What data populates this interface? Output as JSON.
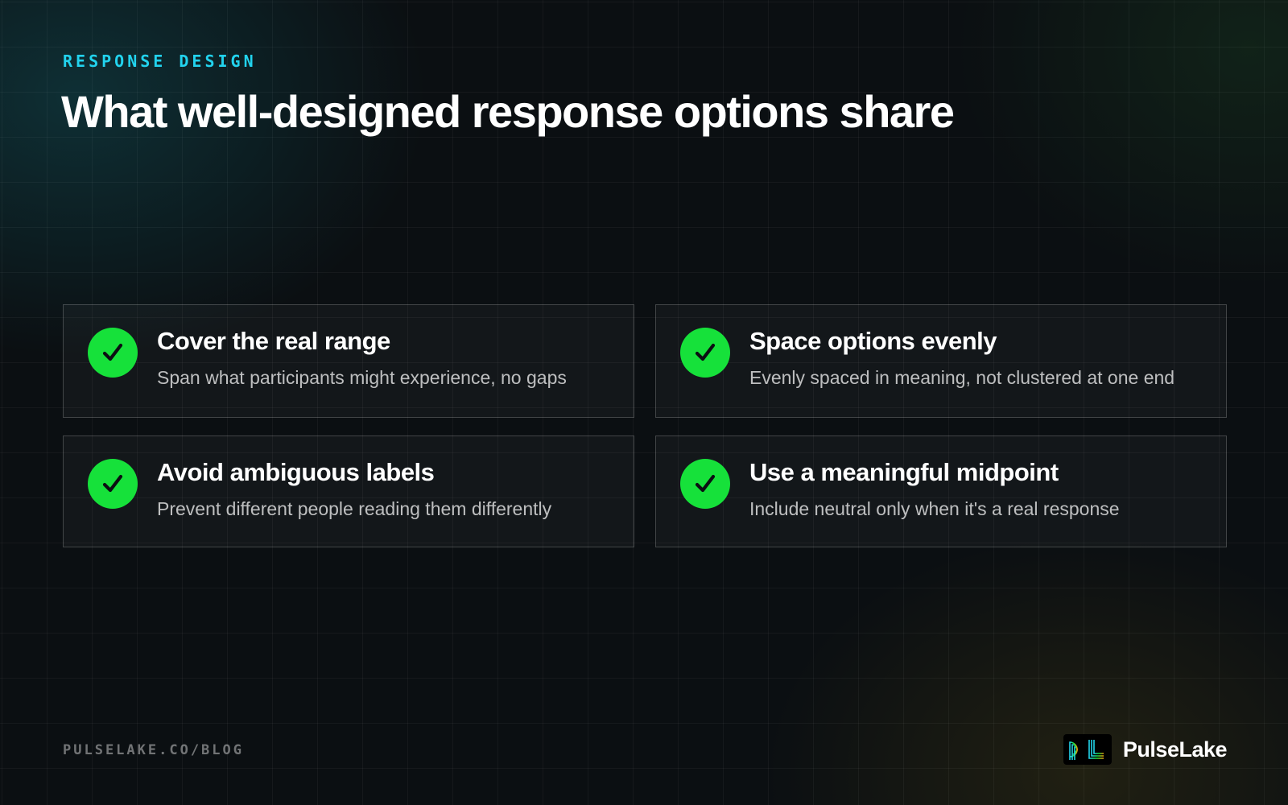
{
  "header": {
    "eyebrow": "RESPONSE DESIGN",
    "title": "What well-designed response options share"
  },
  "cards": [
    {
      "icon": "check-icon",
      "title": "Cover the real range",
      "description": "Span what participants might experience, no gaps"
    },
    {
      "icon": "check-icon",
      "title": "Space options evenly",
      "description": "Evenly spaced in meaning, not clustered at one end"
    },
    {
      "icon": "check-icon",
      "title": "Avoid ambiguous labels",
      "description": "Prevent different people reading them differently"
    },
    {
      "icon": "check-icon",
      "title": "Use a meaningful midpoint",
      "description": "Include neutral only when it's a real response"
    }
  ],
  "footer": {
    "url": "PULSELAKE.CO/BLOG",
    "brand_name": "PulseLake",
    "brand_logo": "pulselake-logo"
  },
  "colors": {
    "accent": "#22d3ee",
    "check": "#16e13a",
    "background": "#0b0f12"
  }
}
